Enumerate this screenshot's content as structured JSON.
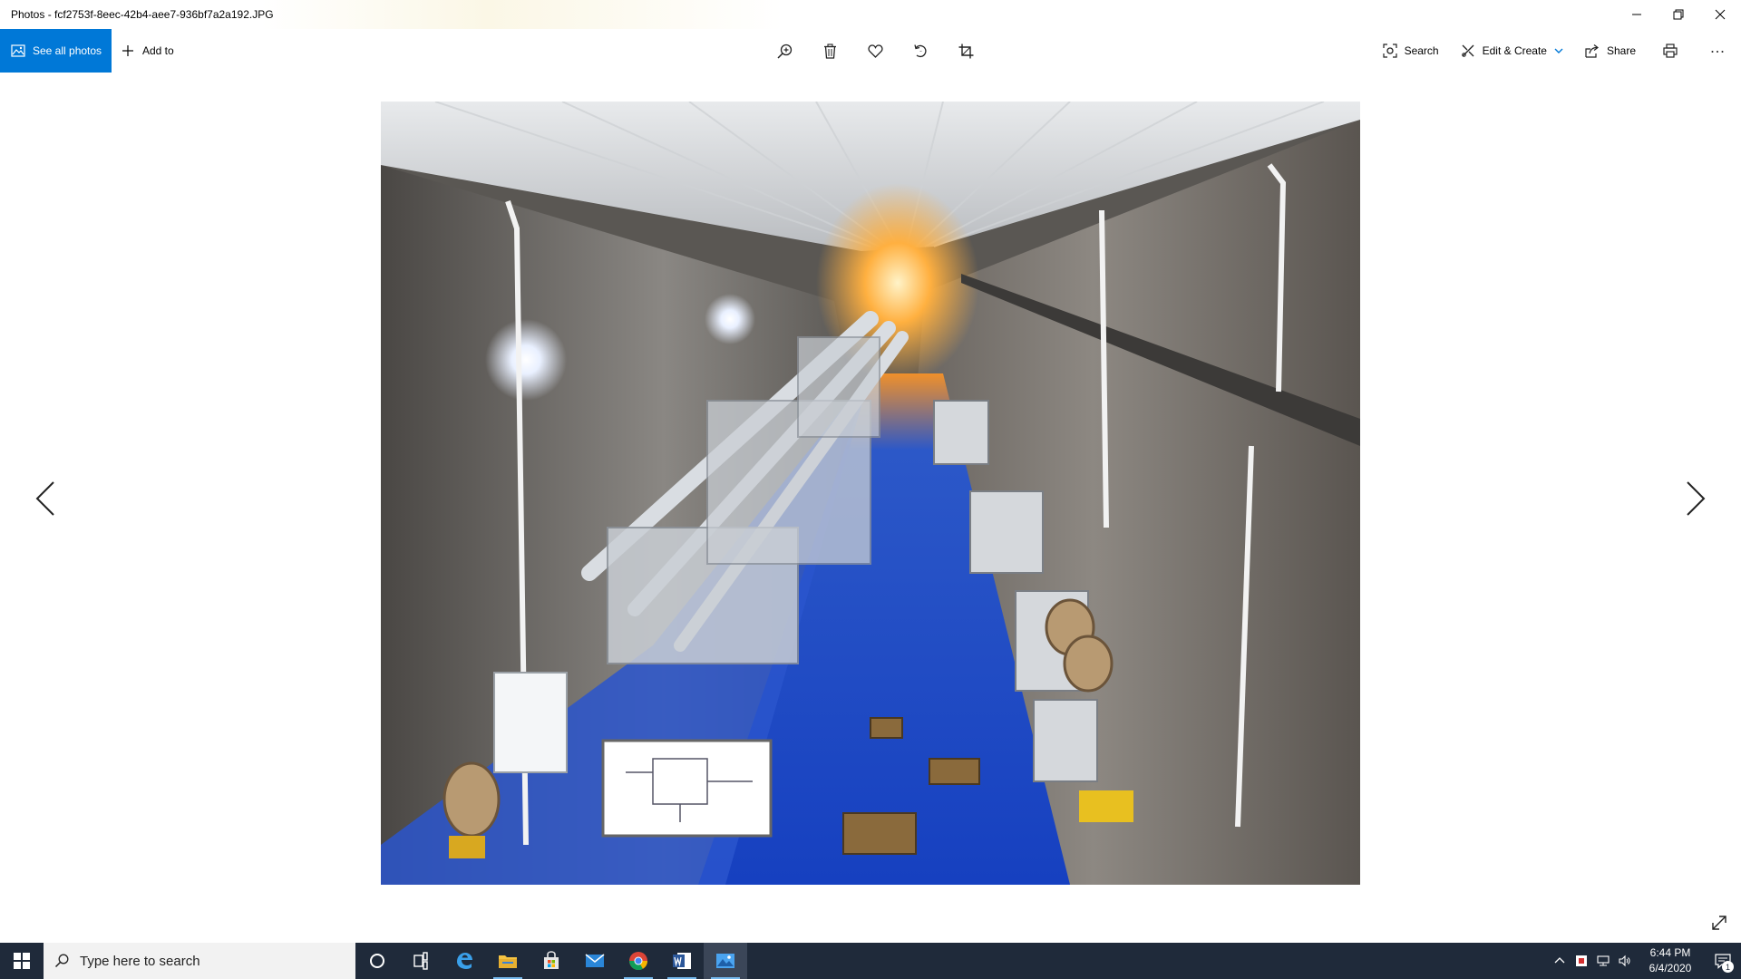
{
  "window": {
    "title": "Photos - fcf2753f-8eec-42b4-aee7-936bf7a2a192.JPG"
  },
  "toolbar": {
    "see_all_photos": "See all photos",
    "add_to": "Add to",
    "search": "Search",
    "edit_create": "Edit & Create",
    "share": "Share",
    "center_icons": [
      "zoom-in-icon",
      "delete-icon",
      "favorite-heart-icon",
      "rotate-icon",
      "crop-icon"
    ]
  },
  "taskbar": {
    "search_placeholder": "Type here to search",
    "time": "6:44 PM",
    "date": "6/4/2020",
    "notification_count": "1",
    "pinned_apps": [
      "cortana",
      "task-view",
      "edge",
      "file-explorer",
      "store",
      "mail",
      "chrome",
      "word",
      "photos"
    ]
  },
  "colors": {
    "accent": "#0078d7",
    "taskbar": "#1f2a3a",
    "floor_blue": "#1a4fd6"
  }
}
